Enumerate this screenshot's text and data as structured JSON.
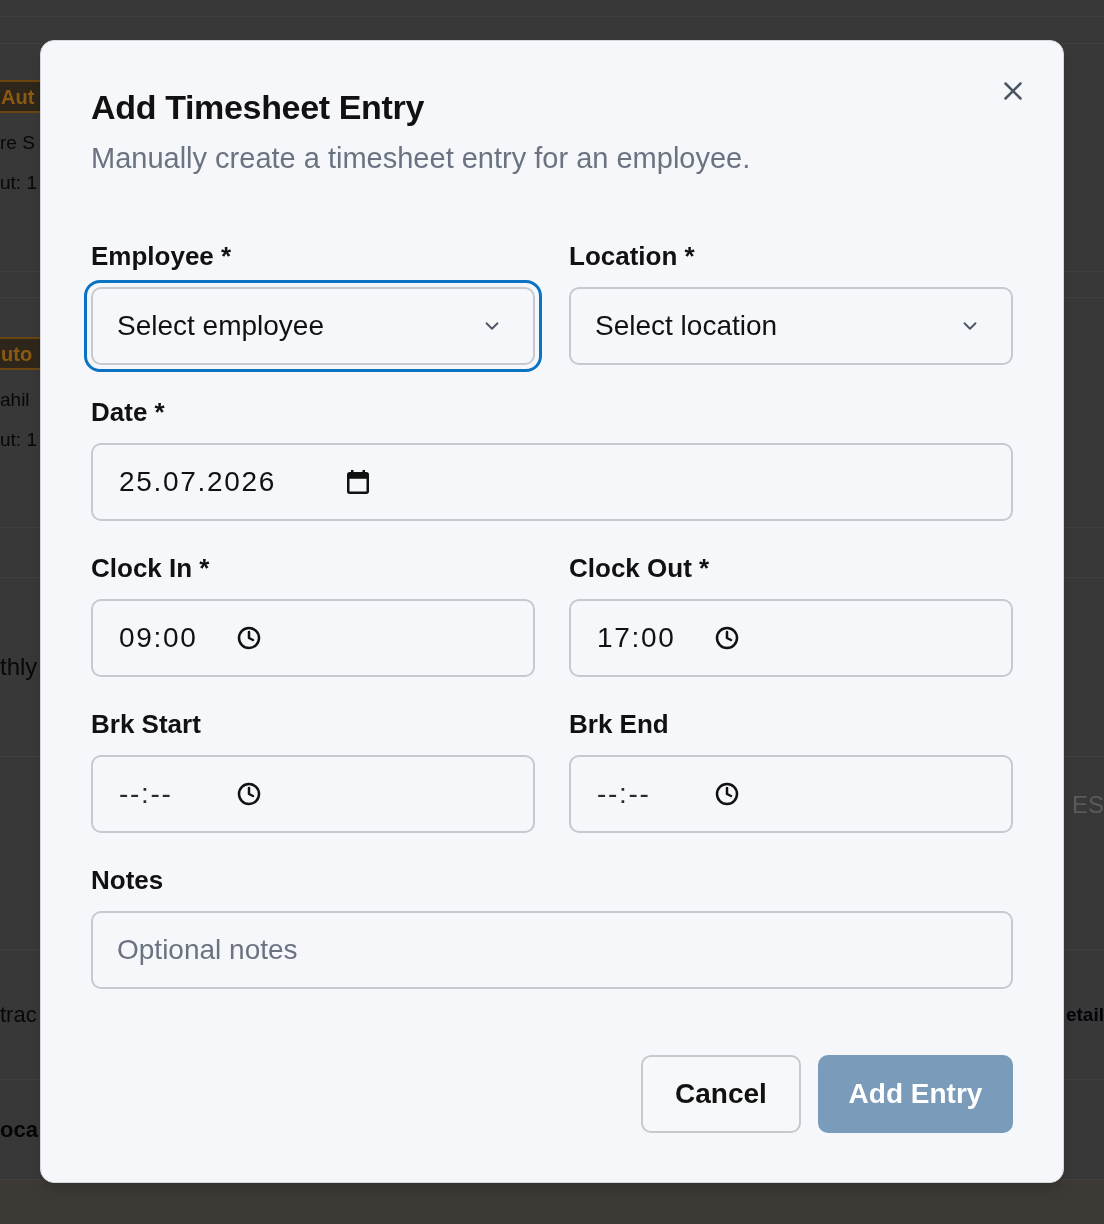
{
  "background": {
    "rows": [
      {
        "kind": "entry",
        "badge": "Aut",
        "lines": [
          "re S",
          "ut: 1"
        ]
      },
      {
        "kind": "entry",
        "badge": "uto",
        "lines": [
          "ahil",
          "ut: 1"
        ]
      },
      {
        "kind": "text",
        "left": "thly"
      },
      {
        "kind": "text",
        "right": "ES"
      },
      {
        "kind": "text",
        "left": "trac",
        "right": "etail"
      },
      {
        "kind": "text",
        "left": "oca"
      }
    ]
  },
  "dialog": {
    "title": "Add Timesheet Entry",
    "description": "Manually create a timesheet entry for an employee.",
    "fields": [
      {
        "kind": "select",
        "label": "Employee *",
        "placeholder": "Select employee",
        "focused": true
      },
      {
        "kind": "select",
        "label": "Location *",
        "placeholder": "Select location",
        "focused": false
      },
      {
        "kind": "date",
        "label": "Date *",
        "value": "25.07.2026"
      },
      {
        "kind": "time",
        "label": "Clock In *",
        "value": "09:00"
      },
      {
        "kind": "time",
        "label": "Clock Out *",
        "value": "17:00"
      },
      {
        "kind": "time",
        "label": "Brk Start",
        "placeholder": "--:--"
      },
      {
        "kind": "time",
        "label": "Brk End",
        "placeholder": "--:--"
      },
      {
        "kind": "text",
        "label": "Notes",
        "placeholder": "Optional notes"
      }
    ],
    "buttons": [
      {
        "kind": "secondary",
        "label": "Cancel",
        "disabled": false
      },
      {
        "kind": "primary",
        "label": "Add Entry",
        "disabled": true
      }
    ]
  }
}
